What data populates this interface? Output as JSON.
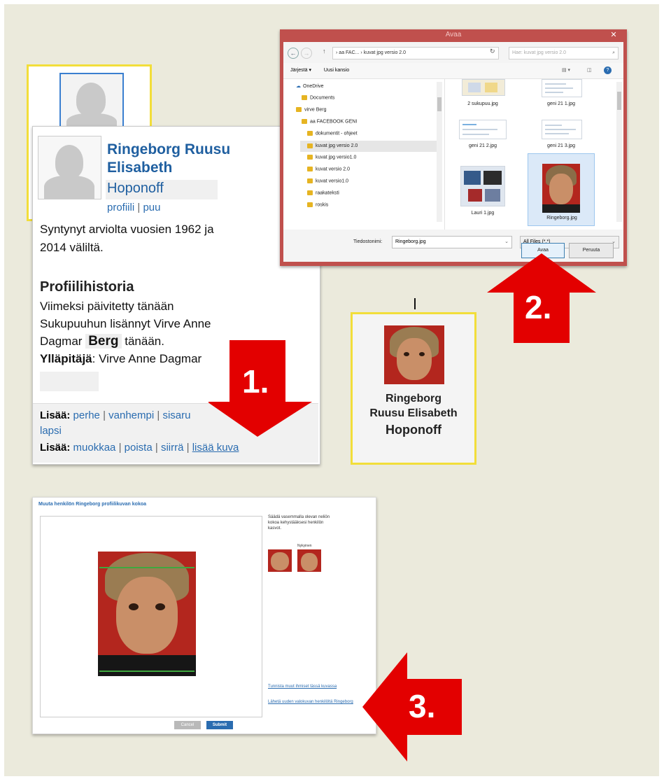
{
  "profile_popup": {
    "name_line1": "Ringeborg Ruusu",
    "name_line2": "Elisabeth",
    "maiden_name": "Hoponoff",
    "link_profile": "profiili",
    "link_sep": "|",
    "link_tree": "puu",
    "born_text_1": "Syntynyt arviolta vuosien 1962 ja",
    "born_text_2": "2014 väliltä.",
    "history_heading": "Profiilihistoria",
    "history_line1": "Viimeksi päivitetty tänään",
    "history_line2": "Sukupuuhun lisännyt Virve Anne",
    "history_line3_a": "Dagmar",
    "history_line3_b": "Berg",
    "history_line3_c": "tänään.",
    "maintainer_label": "Ylläpitäjä",
    "maintainer_value": ": Virve Anne Dagmar",
    "add_label_1": "Lisää:",
    "add_links_1": [
      "perhe",
      "vanhempi",
      "sisaru"
    ],
    "add_links_1b": "lapsi",
    "add_label_2": "Lisää:",
    "add_links_2": [
      "muokkaa",
      "poista",
      "siirrä"
    ],
    "add_photo_link": "lisää kuva"
  },
  "file_dialog": {
    "title": "Avaa",
    "breadcrumb": [
      "aa FAC...",
      "kuvat jpg versio 2.0"
    ],
    "search_placeholder": "Hae: kuvat jpg versio 2.0",
    "toolbar_organize": "Järjestä ▾",
    "toolbar_new_folder": "Uusi kansio",
    "nav_items": [
      "OneDrive",
      "Documents",
      "virve Berg",
      "aa FACEBOOK GENI",
      "dokumentit - ohjeet",
      "kuvat jpg versio 2.0",
      "kuvat jpg versio1.0",
      "kuvat versio 2.0",
      "kuvat versio1.0",
      "raakateksti",
      "roskis"
    ],
    "files": [
      "2 sukupuu.jpg",
      "geni 21 1.jpg",
      "geni 21 2.jpg",
      "geni 21 3.jpg",
      "Lauri 1.jpg",
      "Ringeborg.jpg"
    ],
    "filename_label": "Tiedostonimi:",
    "filename_value": "Ringeborg.jpg",
    "filter_value": "All Files (*.*)",
    "open_button": "Avaa",
    "cancel_button": "Peruuta"
  },
  "result_card": {
    "name_line1": "Ringeborg",
    "name_line2": "Ruusu Elisabeth",
    "name_line3": "Hoponoff"
  },
  "crop_panel": {
    "title": "Muuta henkilön Ringeborg profiilikuvan kokoa",
    "instructions": "Säädä vasemmalla olevan neliön kokoa kehystääksesi henkilön kasvot.",
    "preview_label": "Nykyinen",
    "link_1": "Tunnista muut ihmiset tässä kuvassa",
    "link_2": "Lähetä uuden valokuvan henkilöltä Ringeborg",
    "cancel_button": "Cancel",
    "submit_button": "Submit"
  },
  "step_labels": [
    "1.",
    "2.",
    "3."
  ],
  "colors": {
    "accent_red": "#e30000",
    "link_blue": "#2a6cb0",
    "highlight_yellow": "#f2de3a"
  }
}
